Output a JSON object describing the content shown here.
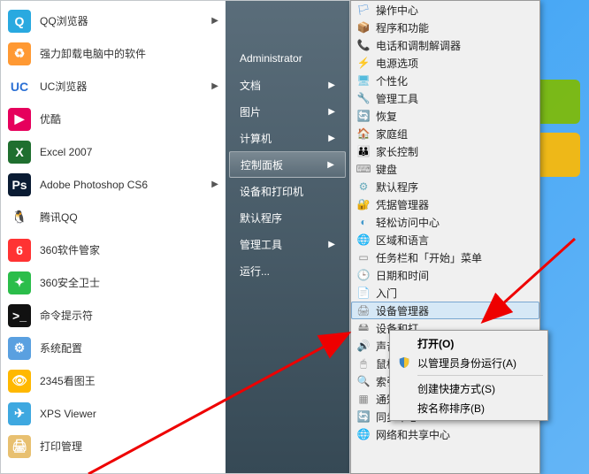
{
  "leftApps": [
    {
      "label": "QQ浏览器",
      "bg": "#29a9e0",
      "txt": "Q",
      "hasArrow": true
    },
    {
      "label": "强力卸载电脑中的软件",
      "bg": "#ff9933",
      "txt": "♻"
    },
    {
      "label": "UC浏览器",
      "bg": "#ffffff",
      "txt": "UC",
      "hasArrow": true,
      "fg": "#2a6fd4"
    },
    {
      "label": "优酷",
      "bg": "#e6005c",
      "txt": "▶"
    },
    {
      "label": "Excel 2007",
      "bg": "#1f6f2f",
      "txt": "X"
    },
    {
      "label": "Adobe Photoshop CS6",
      "bg": "#0a1b33",
      "txt": "Ps",
      "hasArrow": true
    },
    {
      "label": "腾讯QQ",
      "bg": "#ffffff",
      "txt": "🐧",
      "fg": "#222"
    },
    {
      "label": "360软件管家",
      "bg": "#ff3333",
      "txt": "6"
    },
    {
      "label": "360安全卫士",
      "bg": "#2bbd4a",
      "txt": "✦"
    },
    {
      "label": "命令提示符",
      "bg": "#111111",
      "txt": ">_"
    },
    {
      "label": "系统配置",
      "bg": "#5aa0e0",
      "txt": "⚙"
    },
    {
      "label": "2345看图王",
      "bg": "#ffb800",
      "txt": "👁"
    },
    {
      "label": "XPS Viewer",
      "bg": "#3ea8e0",
      "txt": "✈"
    },
    {
      "label": "打印管理",
      "bg": "#e8c070",
      "txt": "🖨"
    }
  ],
  "rightItems": [
    {
      "label": "Administrator"
    },
    {
      "label": "文档",
      "arrow": true
    },
    {
      "label": "图片",
      "arrow": true
    },
    {
      "label": "计算机",
      "arrow": true
    },
    {
      "label": "控制面板",
      "arrow": true,
      "selected": true
    },
    {
      "label": "设备和打印机"
    },
    {
      "label": "默认程序"
    },
    {
      "label": "管理工具",
      "arrow": true
    },
    {
      "label": "运行..."
    }
  ],
  "cpItems": [
    {
      "label": "操作中心",
      "ic": "🏳",
      "c": "#4a90d9"
    },
    {
      "label": "程序和功能",
      "ic": "📦",
      "c": "#d98f3e"
    },
    {
      "label": "电话和调制解调器",
      "ic": "📞",
      "c": "#caa"
    },
    {
      "label": "电源选项",
      "ic": "⚡",
      "c": "#6a6"
    },
    {
      "label": "个性化",
      "ic": "🖥",
      "c": "#5bd"
    },
    {
      "label": "管理工具",
      "ic": "🔧",
      "c": "#79c"
    },
    {
      "label": "恢复",
      "ic": "🔄",
      "c": "#5ad"
    },
    {
      "label": "家庭组",
      "ic": "🏠",
      "c": "#6b8"
    },
    {
      "label": "家长控制",
      "ic": "👪",
      "c": "#ec6"
    },
    {
      "label": "键盘",
      "ic": "⌨",
      "c": "#888"
    },
    {
      "label": "默认程序",
      "ic": "⚙",
      "c": "#6ab"
    },
    {
      "label": "凭据管理器",
      "ic": "🔐",
      "c": "#b83"
    },
    {
      "label": "轻松访问中心",
      "ic": "◐",
      "c": "#49c"
    },
    {
      "label": "区域和语言",
      "ic": "🌐",
      "c": "#49c"
    },
    {
      "label": "任务栏和「开始」菜单",
      "ic": "▭",
      "c": "#888"
    },
    {
      "label": "日期和时间",
      "ic": "🕒",
      "c": "#5ad"
    },
    {
      "label": "入门",
      "ic": "📄",
      "c": "#6bd"
    },
    {
      "label": "设备管理器",
      "ic": "🖨",
      "c": "#888",
      "hover": true
    },
    {
      "label": "设备和打",
      "ic": "🖴",
      "c": "#888"
    },
    {
      "label": "声音",
      "ic": "🔊",
      "c": "#888"
    },
    {
      "label": "鼠标",
      "ic": "🖱",
      "c": "#888"
    },
    {
      "label": "索引选项",
      "ic": "🔍",
      "c": "#5ad"
    },
    {
      "label": "通知区域图标",
      "ic": "▦",
      "c": "#888"
    },
    {
      "label": "同步中心",
      "ic": "🔄",
      "c": "#3b7"
    },
    {
      "label": "网络和共享中心",
      "ic": "🌐",
      "c": "#49c"
    }
  ],
  "ctx": {
    "open": "打开(O)",
    "admin": "以管理员身份运行(A)",
    "shortcut": "创建快捷方式(S)",
    "sort": "按名称排序(B)"
  }
}
